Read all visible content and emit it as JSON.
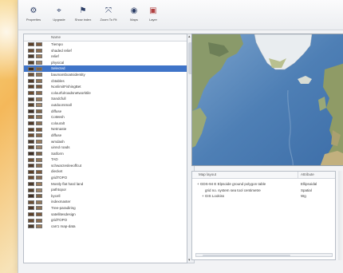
{
  "toolbar": {
    "buttons": [
      {
        "label": "Properties",
        "icon": "gear-icon",
        "glyph": "⚙"
      },
      {
        "label": "Upgrade",
        "icon": "pin-icon",
        "glyph": "⌖"
      },
      {
        "label": "Show index",
        "icon": "pin-flag-icon",
        "glyph": "⚑"
      },
      {
        "label": "Zoom To Fit",
        "icon": "zoom-fit-icon",
        "glyph": "⤧"
      },
      {
        "label": "Maps",
        "icon": "globe-icon",
        "glyph": "◉"
      },
      {
        "label": "Layer",
        "icon": "layer-icon",
        "glyph": "▣"
      }
    ]
  },
  "list": {
    "header": "Name",
    "selected_index": 4,
    "rows": [
      "Tiempo",
      "shaded relief",
      "relief",
      "physical",
      "Selected",
      "baumarsboatsidentity",
      "cbtables",
      "NonlimitFishingBet",
      "colourfulroadsnetworktile",
      "Sandcfull",
      "outdoorsmall",
      "diffuse",
      "CoMesh",
      "colouralt",
      "Netmaste",
      "diffuse",
      "wmdash",
      "uinnd roads",
      "Satform",
      "TAD",
      "schwarzesleeoffcut",
      "diecket",
      "gridTOPO",
      "Mostly flat hard land",
      "pathtopor",
      "bycell",
      "indexmaster",
      "Tree-paradiring",
      "satellitesdesign",
      "gridTOPO",
      "carr1 map-data"
    ]
  },
  "info": {
    "col_key": "Map layout",
    "col_value": "Attribute",
    "rows": [
      {
        "key": "+ GDS-94 E Elpsoide ground polygon table",
        "value": "Ellipsoidal",
        "indent": 0
      },
      {
        "key": "grid no. system sea tool centimetre",
        "value": "Spatial",
        "indent": 10
      },
      {
        "key": "+ GIS Lookiss",
        "value": "Wg",
        "indent": 6
      }
    ]
  },
  "colors": {
    "selection": "#3f74c8",
    "ocean": "#5a86b8",
    "land": "#8a9a6a",
    "ice": "#e9edf0"
  }
}
